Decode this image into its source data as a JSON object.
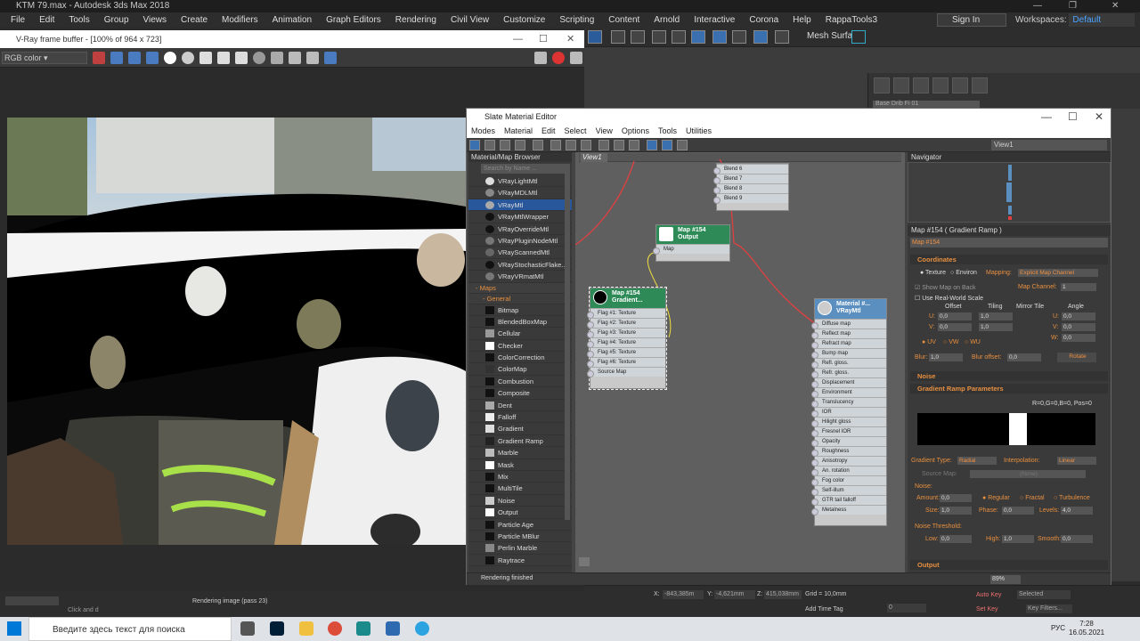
{
  "max": {
    "title": "KTM 79.max - Autodesk 3ds Max 2018",
    "menu": [
      "File",
      "Edit",
      "Tools",
      "Group",
      "Views",
      "Create",
      "Modifiers",
      "Animation",
      "Graph Editors",
      "Rendering",
      "Civil View",
      "Customize",
      "Scripting",
      "Content",
      "Arnold",
      "Interactive",
      "Corona",
      "Help",
      "RappaTools3"
    ],
    "sign_in": "Sign In",
    "workspaces_label": "Workspaces:",
    "workspaces_value": "Default",
    "mesh_surface": "Mesh Surface",
    "command_panel_name": "Base Drib Fi 01"
  },
  "vfb": {
    "title": "V-Ray frame buffer - [100% of 964 x 723]",
    "channel": "RGB color",
    "status_left": "Click and d",
    "status_render": "Rendering image (pass 23)"
  },
  "sme": {
    "title": "Slate Material Editor",
    "menu": [
      "Modes",
      "Material",
      "Edit",
      "Select",
      "View",
      "Options",
      "Tools",
      "Utilities"
    ],
    "view_select": "View1",
    "view_tab": "View1",
    "browser": {
      "header": "Material/Map Browser",
      "search_placeholder": "Search by Name ...",
      "materials": [
        "VRayLightMtl",
        "VRayMDLMtl",
        "VRayMtl",
        "VRayMtlWrapper",
        "VRayOverrideMtl",
        "VRayPluginNodeMtl",
        "VRayScannedMtl",
        "VRayStochasticFlake...",
        "VRayVRmatMtl"
      ],
      "maps_group": "- Maps",
      "general_group": "- General",
      "maps": [
        "Bitmap",
        "BlendedBoxMap",
        "Cellular",
        "Checker",
        "ColorCorrection",
        "ColorMap",
        "Combustion",
        "Composite",
        "Dent",
        "Falloff",
        "Gradient",
        "Gradient Ramp",
        "Marble",
        "Mask",
        "Mix",
        "MultiTile",
        "Noise",
        "Output",
        "Particle Age",
        "Particle MBlur",
        "Perlin Marble",
        "Raytrace"
      ]
    },
    "nodes": {
      "blend_slots": [
        "Blend 6",
        "Blend 7",
        "Blend 8",
        "Blend 9"
      ],
      "output": {
        "title1": "Map #154",
        "title2": "Output",
        "slots": [
          "Map"
        ]
      },
      "gradient": {
        "title1": "Map #154",
        "title2": "Gradient...",
        "slots": [
          "Flag #1: Texture",
          "Flag #2: Texture",
          "Flag #3: Texture",
          "Flag #4: Texture",
          "Flag #5: Texture",
          "Flag #6: Texture",
          "Source Map"
        ]
      },
      "material": {
        "title1": "Material #...",
        "title2": "VRayMtl",
        "slots": [
          "Diffuse map",
          "Reflect map",
          "Refract map",
          "Bump map",
          "Refl. gloss.",
          "Refr. gloss.",
          "Displacement",
          "Environment",
          "Translucency",
          "IOR",
          "Hilight gloss",
          "Fresnel IOR",
          "Opacity",
          "Roughness",
          "Anisotropy",
          "An. rotation",
          "Fog color",
          "Self-illum",
          "GTR tail falloff",
          "Metalness"
        ]
      }
    },
    "navigator": "Navigator",
    "params": {
      "header": "Map #154  ( Gradient Ramp )",
      "name": "Map #154",
      "coordinates": "Coordinates",
      "texture": "Texture",
      "environ": "Environ",
      "mapping_label": "Mapping:",
      "mapping_value": "Explicit Map Channel",
      "show_map": "Show Map on Back",
      "map_channel_label": "Map Channel:",
      "map_channel_value": "1",
      "real_world": "Use Real-World Scale",
      "offset": "Offset",
      "tiling": "Tiling",
      "mirror_tile": "Mirror Tile",
      "angle": "Angle",
      "u": "U:",
      "v": "V:",
      "w": "W:",
      "u_offset": "0,0",
      "v_offset": "0,0",
      "u_tiling": "1,0",
      "v_tiling": "1,0",
      "u_angle": "0,0",
      "v_angle": "0,0",
      "w_angle": "0,0",
      "uv": "UV",
      "vw": "VW",
      "wu": "WU",
      "blur_label": "Blur:",
      "blur_value": "1,0",
      "blur_offset_label": "Blur offset:",
      "blur_offset_value": "0,0",
      "rotate": "Rotate",
      "noise": "Noise",
      "gradient_params": "Gradient Ramp Parameters",
      "gradient_info": "R=0,G=0,B=0, Pos=0",
      "gradient_type_label": "Gradient Type:",
      "gradient_type_value": "Radial",
      "interpolation_label": "Interpolation:",
      "interpolation_value": "Linear",
      "source_map_label": "Source Map:",
      "source_map_value": "(None)",
      "noise_group": "Noise:",
      "amount_label": "Amount:",
      "amount_value": "0,0",
      "regular": "Regular",
      "fractal": "Fractal",
      "turbulence": "Turbulence",
      "size_label": "Size:",
      "size_value": "1,0",
      "phase_label": "Phase:",
      "phase_value": "0,0",
      "levels_label": "Levels:",
      "levels_value": "4,0",
      "noise_threshold": "Noise Threshold:",
      "low_label": "Low:",
      "low_value": "0,0",
      "high_label": "High:",
      "high_value": "1,0",
      "smooth_label": "Smooth:",
      "smooth_value": "0,0",
      "output": "Output"
    },
    "status": "Rendering finished",
    "zoom": "89%"
  },
  "bottom": {
    "x_label": "X:",
    "x_value": "-843,385m",
    "y_label": "Y:",
    "y_value": "-4,621mm",
    "z_label": "Z:",
    "z_value": "415,038mm",
    "grid": "Grid = 10,0mm",
    "add_time_tag": "Add Time Tag",
    "auto_key": "Auto Key",
    "selected": "Selected",
    "set_key": "Set Key",
    "key_filters": "Key Filters...",
    "frame": "0"
  },
  "taskbar": {
    "search": "Введите здесь текст для поиска",
    "lang": "РУС",
    "time": "7:28",
    "date": "16.05.2021"
  },
  "colors": {
    "accent_blue": "#28579b",
    "orange_label": "#e89040",
    "node_green": "#2e8b57",
    "node_blue": "#5b8fbf",
    "wire_red": "#e04040"
  }
}
